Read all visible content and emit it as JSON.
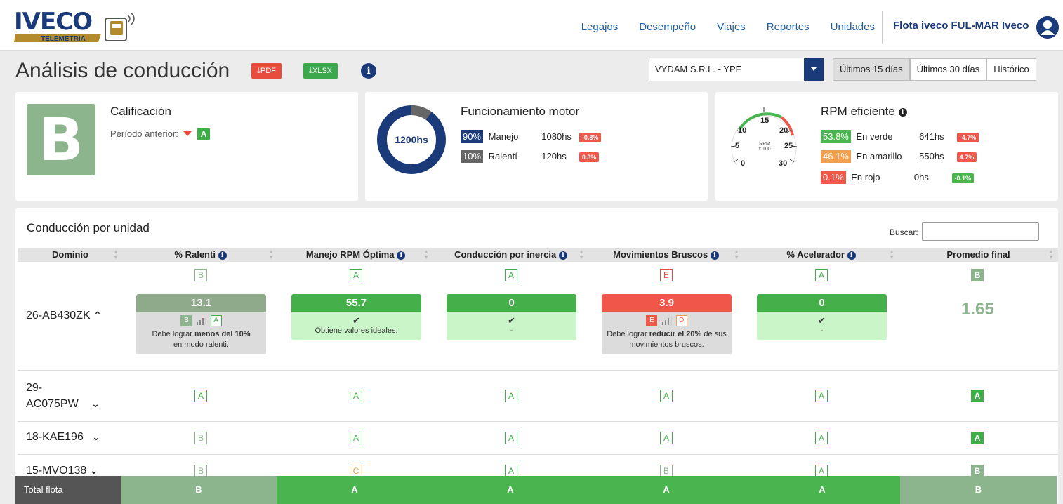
{
  "brand": {
    "logo_text": "IVECO",
    "logo_sub": "TELEMETRIA"
  },
  "nav": {
    "links": [
      "Legajos",
      "Desempeño",
      "Viajes",
      "Reportes",
      "Unidades"
    ],
    "fleet": "Flota iveco FUL-MAR Iveco"
  },
  "header": {
    "title": "Análisis de conducción",
    "pdf": "PDF",
    "xlsx": "XLSX",
    "company": "VYDAM S.R.L. - YPF",
    "periods": [
      "Últimos 15 días",
      "Últimos 30 días",
      "Histórico"
    ]
  },
  "rating": {
    "title": "Calificación",
    "grade": "B",
    "prev_label": "Período anterior:",
    "prev_grade": "A"
  },
  "motor": {
    "title": "Funcionamiento motor",
    "total": "1200hs",
    "driving_fraction": 0.9,
    "rows": [
      {
        "pct": "90%",
        "label": "Manejo",
        "hours": "1080hs",
        "delta": "-0.8%",
        "color": "#1a3a7a"
      },
      {
        "pct": "10%",
        "label": "Ralentí",
        "hours": "120hs",
        "delta": "0.8%",
        "color": "#666666"
      }
    ]
  },
  "rpm": {
    "title": "RPM eficiente",
    "gauge_ticks": [
      "0",
      "5",
      "10",
      "15",
      "20",
      "25",
      "30"
    ],
    "gauge_unit": "RPM",
    "gauge_unit2": "x 100",
    "rows": [
      {
        "pct": "53.8%",
        "label": "En verde",
        "hours": "641hs",
        "delta": "-4.7%",
        "color": "#4ab54f",
        "delta_color": "#f0564a"
      },
      {
        "pct": "46.1%",
        "label": "En amarillo",
        "hours": "550hs",
        "delta": "4.7%",
        "color": "#f0a050",
        "delta_color": "#f0564a"
      },
      {
        "pct": "0.1%",
        "label": "En rojo",
        "hours": "0hs",
        "delta": "-0.1%",
        "color": "#f0564a",
        "delta_color": "#4ab54f"
      }
    ]
  },
  "table": {
    "title": "Conducción por unidad",
    "search_label": "Buscar:",
    "columns": [
      "Dominio",
      "% Ralenti",
      "Manejo RPM Óptima",
      "Conducción por inercia",
      "Movimientos Bruscos",
      "% Acelerador",
      "Promedio final"
    ],
    "expanded": {
      "domain": "26-AB430ZK",
      "grades": [
        "B",
        "A",
        "A",
        "E",
        "A",
        "B"
      ],
      "values": [
        "13.1",
        "55.7",
        "0",
        "3.9",
        "0"
      ],
      "ralenti_trend": [
        "B",
        "A"
      ],
      "ralenti_msg_pre": "Debe lograr",
      "ralenti_msg_bold": "menos del 10%",
      "ralenti_msg_post": "en modo ralenti.",
      "rpm_msg": "Obtiene valores ideales.",
      "dash": "-",
      "bruscos_trend": [
        "E",
        "D"
      ],
      "bruscos_msg_pre": "Debe lograr",
      "bruscos_msg_bold": "reducir el 20%",
      "bruscos_msg_post": "de sus movimientos bruscos.",
      "average": "1.65"
    },
    "rows": [
      {
        "domain_l1": "29-",
        "domain_l2": "AC075PW",
        "grades": [
          "A",
          "A",
          "A",
          "A",
          "A",
          "A"
        ]
      },
      {
        "domain_l1": "18-KAE196",
        "domain_l2": "",
        "grades": [
          "B",
          "A",
          "A",
          "A",
          "A",
          "A"
        ]
      },
      {
        "domain_l1": "15-MVO138",
        "domain_l2": "",
        "grades": [
          "B",
          "C",
          "A",
          "B",
          "A",
          "B"
        ]
      }
    ]
  },
  "footer": {
    "label": "Total flota",
    "grades": [
      "B",
      "A",
      "A",
      "A",
      "A",
      "B"
    ]
  }
}
